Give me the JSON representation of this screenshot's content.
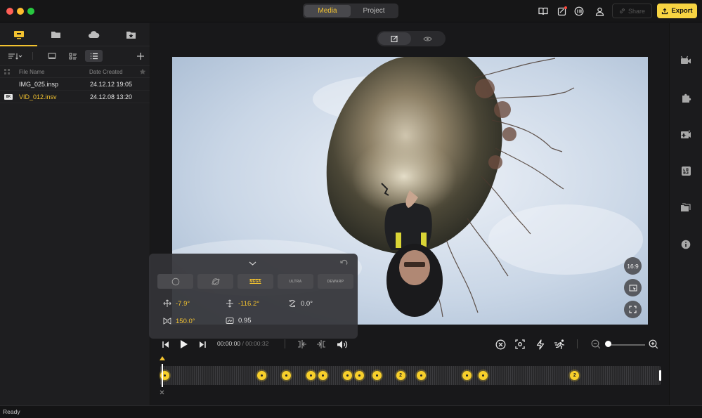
{
  "titlebar": {
    "tabs": [
      {
        "label": "Media",
        "active": true
      },
      {
        "label": "Project",
        "active": false
      }
    ],
    "share_label": "Share",
    "export_label": "Export",
    "icons": [
      "book-icon",
      "edit-badge-icon",
      "speed-icon",
      "account-icon"
    ]
  },
  "media_panel": {
    "tabs": [
      "local-media-icon",
      "folder-icon",
      "cloud-icon",
      "favorites-icon"
    ],
    "columns": {
      "name": "File Name",
      "date": "Date Created"
    },
    "files": [
      {
        "name": "IMG_025.insp",
        "date": "24.12.12 19:05",
        "badge": "",
        "selected": false
      },
      {
        "name": "VID_012.insv",
        "date": "24.12.08 13:20",
        "badge": "8K",
        "selected": true
      }
    ]
  },
  "viewer": {
    "aspect_label": "16:9"
  },
  "lens_panel": {
    "modes": [
      "",
      "",
      "MEGA",
      "ULTRA",
      "DEWARP"
    ],
    "active_mode": "MEGA",
    "pan": "-7.9°",
    "tilt": "-116.2°",
    "roll": "0.0°",
    "fov": "150.0°",
    "distance": "0.95"
  },
  "playback": {
    "current_time": "00:00:00",
    "separator": "/",
    "total_time": "00:00:32",
    "zoom_level": 0.0
  },
  "timeline": {
    "keyframes": [
      {
        "pos": 0.0,
        "label": ""
      },
      {
        "pos": 0.2,
        "label": ""
      },
      {
        "pos": 0.25,
        "label": ""
      },
      {
        "pos": 0.3,
        "label": ""
      },
      {
        "pos": 0.325,
        "label": ""
      },
      {
        "pos": 0.375,
        "label": ""
      },
      {
        "pos": 0.4,
        "label": ""
      },
      {
        "pos": 0.437,
        "label": ""
      },
      {
        "pos": 0.485,
        "label": "2"
      },
      {
        "pos": 0.527,
        "label": ""
      },
      {
        "pos": 0.622,
        "label": ""
      },
      {
        "pos": 0.654,
        "label": ""
      },
      {
        "pos": 0.843,
        "label": "2"
      }
    ]
  },
  "status": {
    "text": "Ready"
  },
  "colors": {
    "accent": "#f2c230",
    "export_bg": "#f7d442"
  }
}
